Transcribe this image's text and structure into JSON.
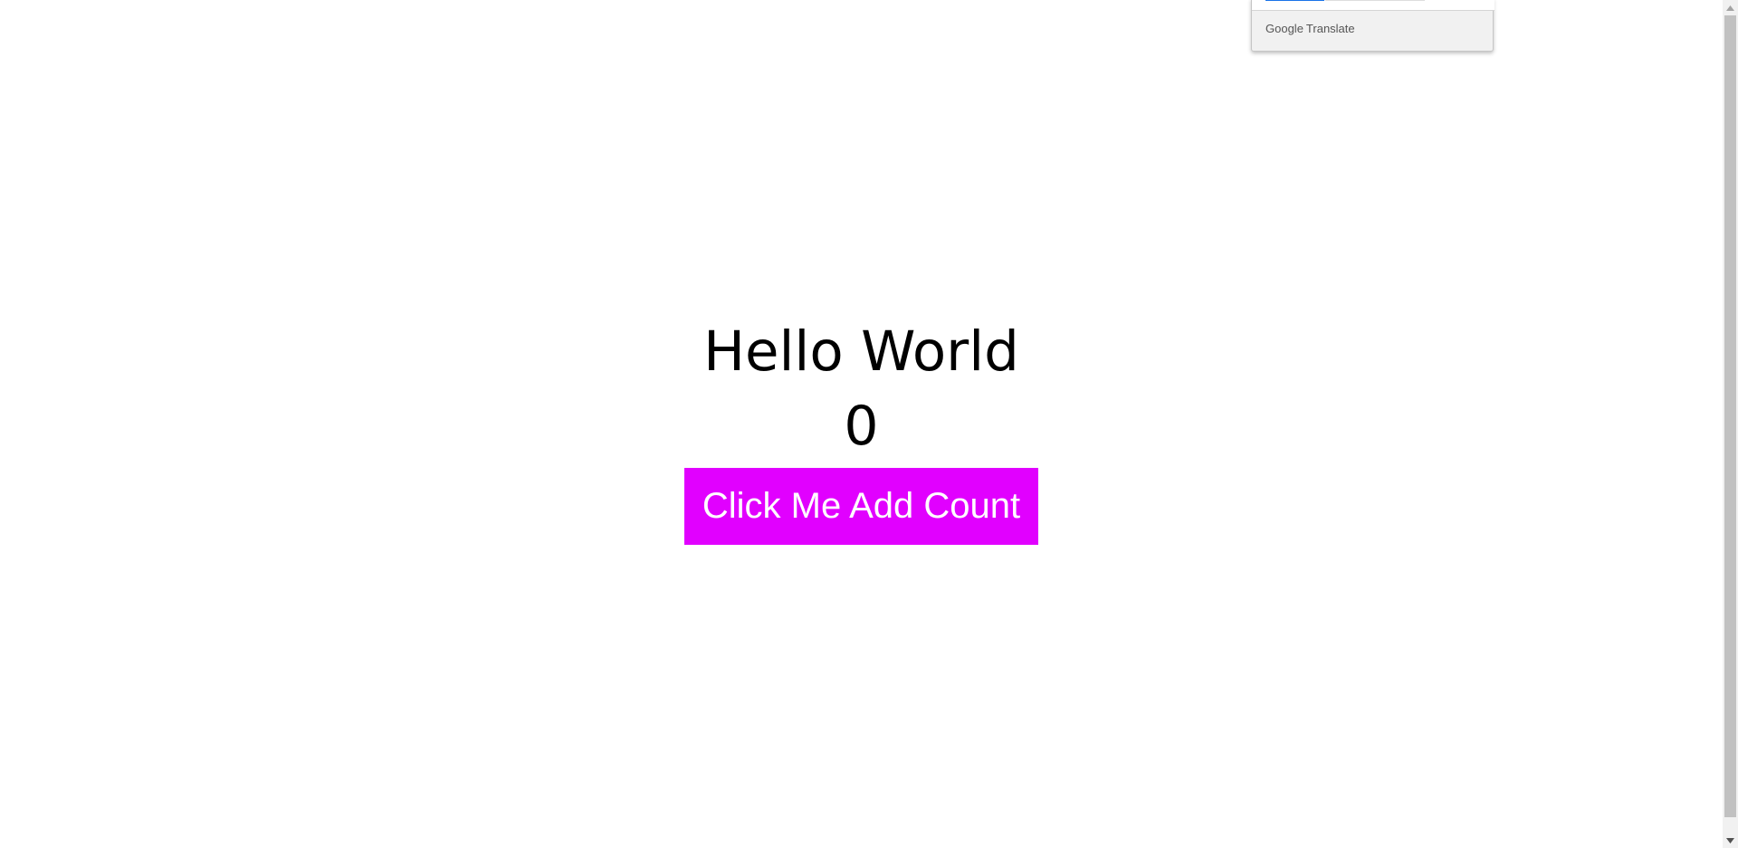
{
  "main": {
    "heading": "Hello World",
    "count": "0",
    "button_label": "Click Me Add Count",
    "button_color": "#e100ff"
  },
  "translate_popup": {
    "brand": "Google",
    "product": "Translate"
  },
  "scrollbar": {
    "up_icon": "scroll-up-arrow-icon",
    "down_icon": "scroll-down-arrow-icon"
  }
}
